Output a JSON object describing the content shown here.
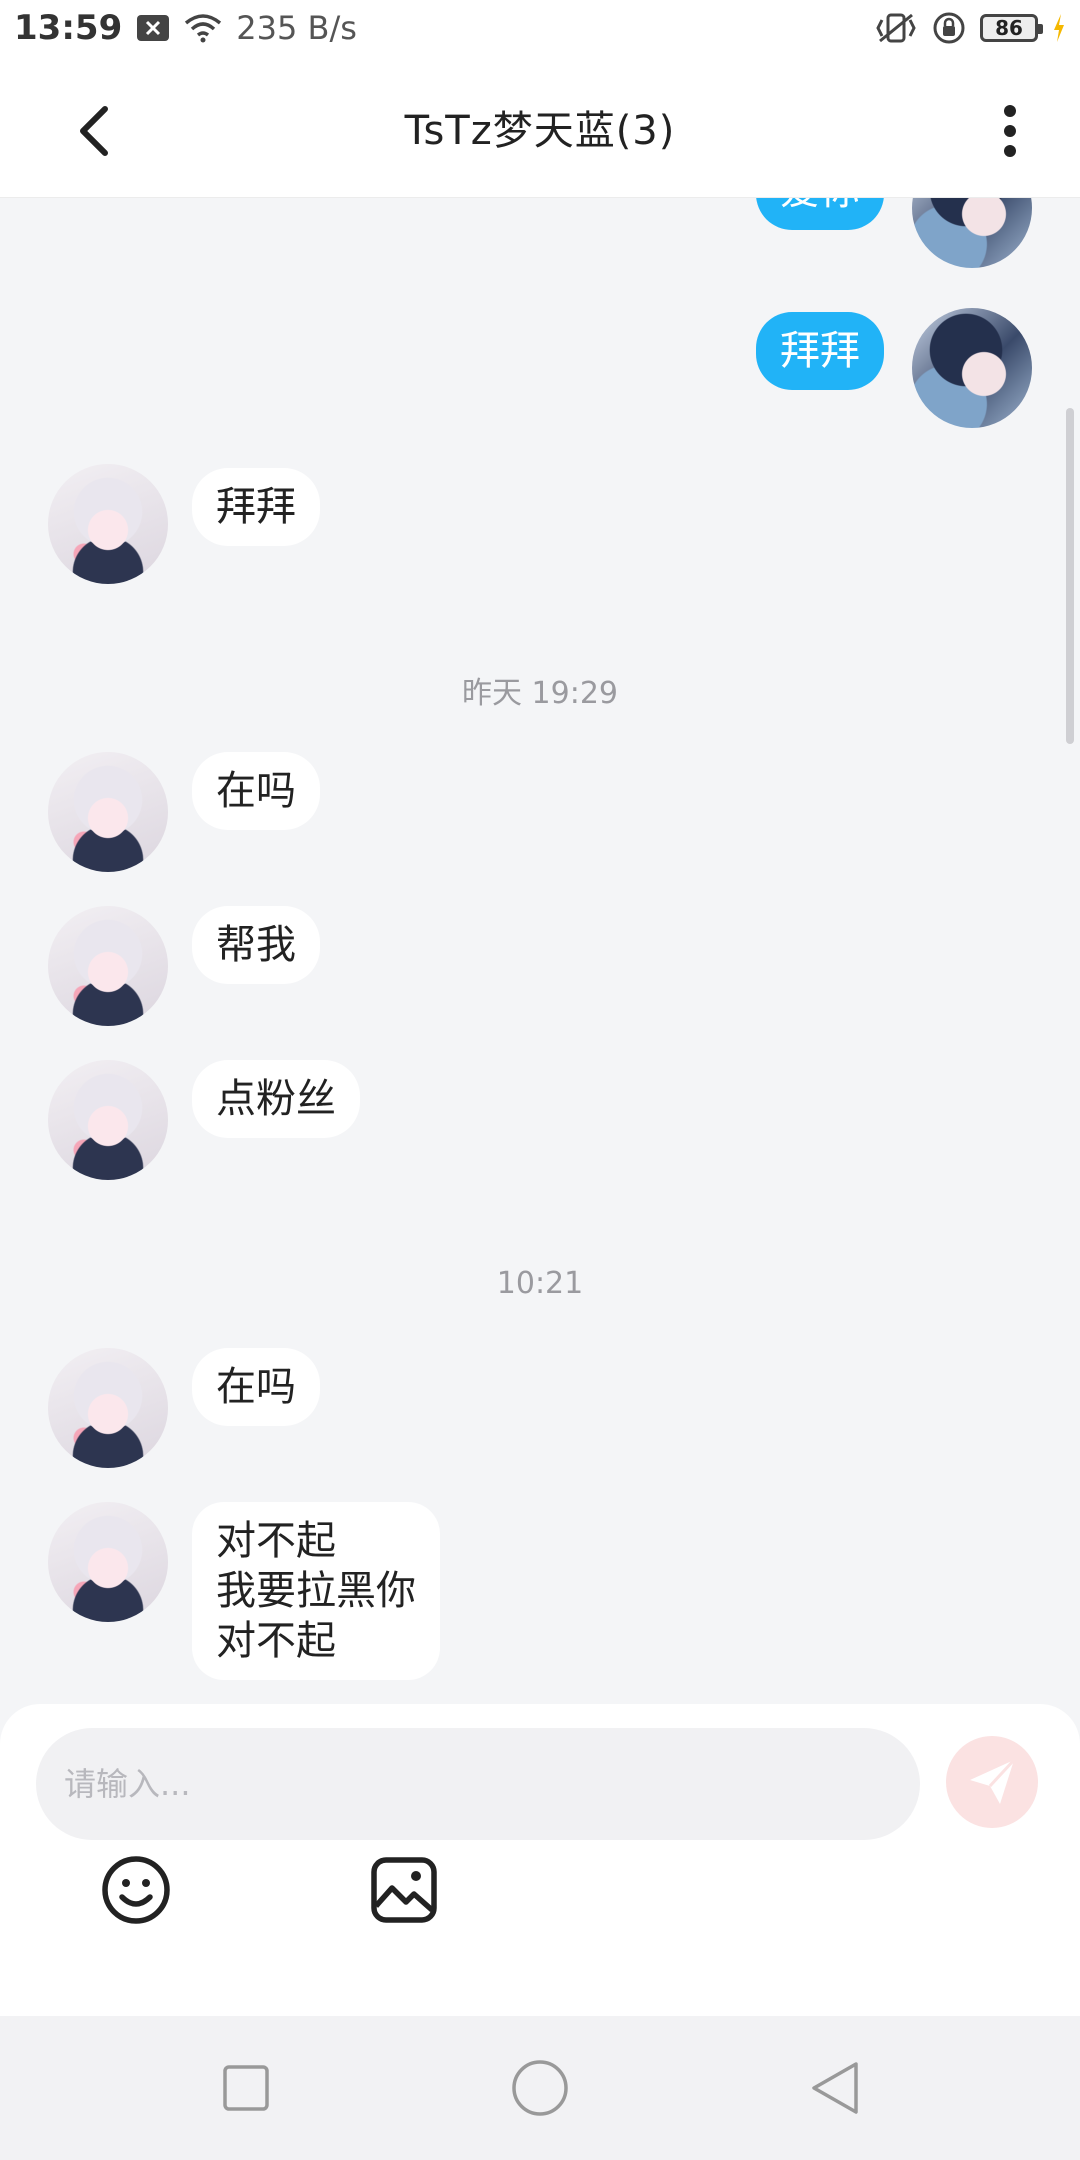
{
  "status_bar": {
    "time": "13:59",
    "net_speed": "235 B/s",
    "battery": "86",
    "icons": [
      "sim-disabled-icon",
      "wifi-icon",
      "vibrate-icon",
      "rotation-lock-icon",
      "battery-icon",
      "charging-icon"
    ]
  },
  "header": {
    "title": "TsTz梦天蓝(3)",
    "back_icon": "chevron-left-icon",
    "more_icon": "more-vertical-icon"
  },
  "messages": [
    {
      "side": "out",
      "text": "爱你"
    },
    {
      "side": "out",
      "text": "拜拜"
    },
    {
      "side": "in",
      "text": "拜拜"
    },
    {
      "side": "time",
      "text": "昨天 19:29"
    },
    {
      "side": "in",
      "text": "在吗"
    },
    {
      "side": "in",
      "text": "帮我"
    },
    {
      "side": "in",
      "text": "点粉丝"
    },
    {
      "side": "time",
      "text": "10:21"
    },
    {
      "side": "in",
      "text": "在吗"
    },
    {
      "side": "in",
      "lines": [
        "对不起",
        "我要拉黑你",
        "对不起"
      ]
    }
  ],
  "input": {
    "placeholder": "请输入...",
    "send_icon": "paper-plane-icon",
    "emoji_icon": "smiley-icon",
    "image_icon": "image-icon"
  },
  "colors": {
    "outgoing_bubble": "#21b3f7",
    "incoming_bubble": "#ffffff",
    "chat_background": "#f4f5f7",
    "send_button": "#fbe2e2"
  }
}
